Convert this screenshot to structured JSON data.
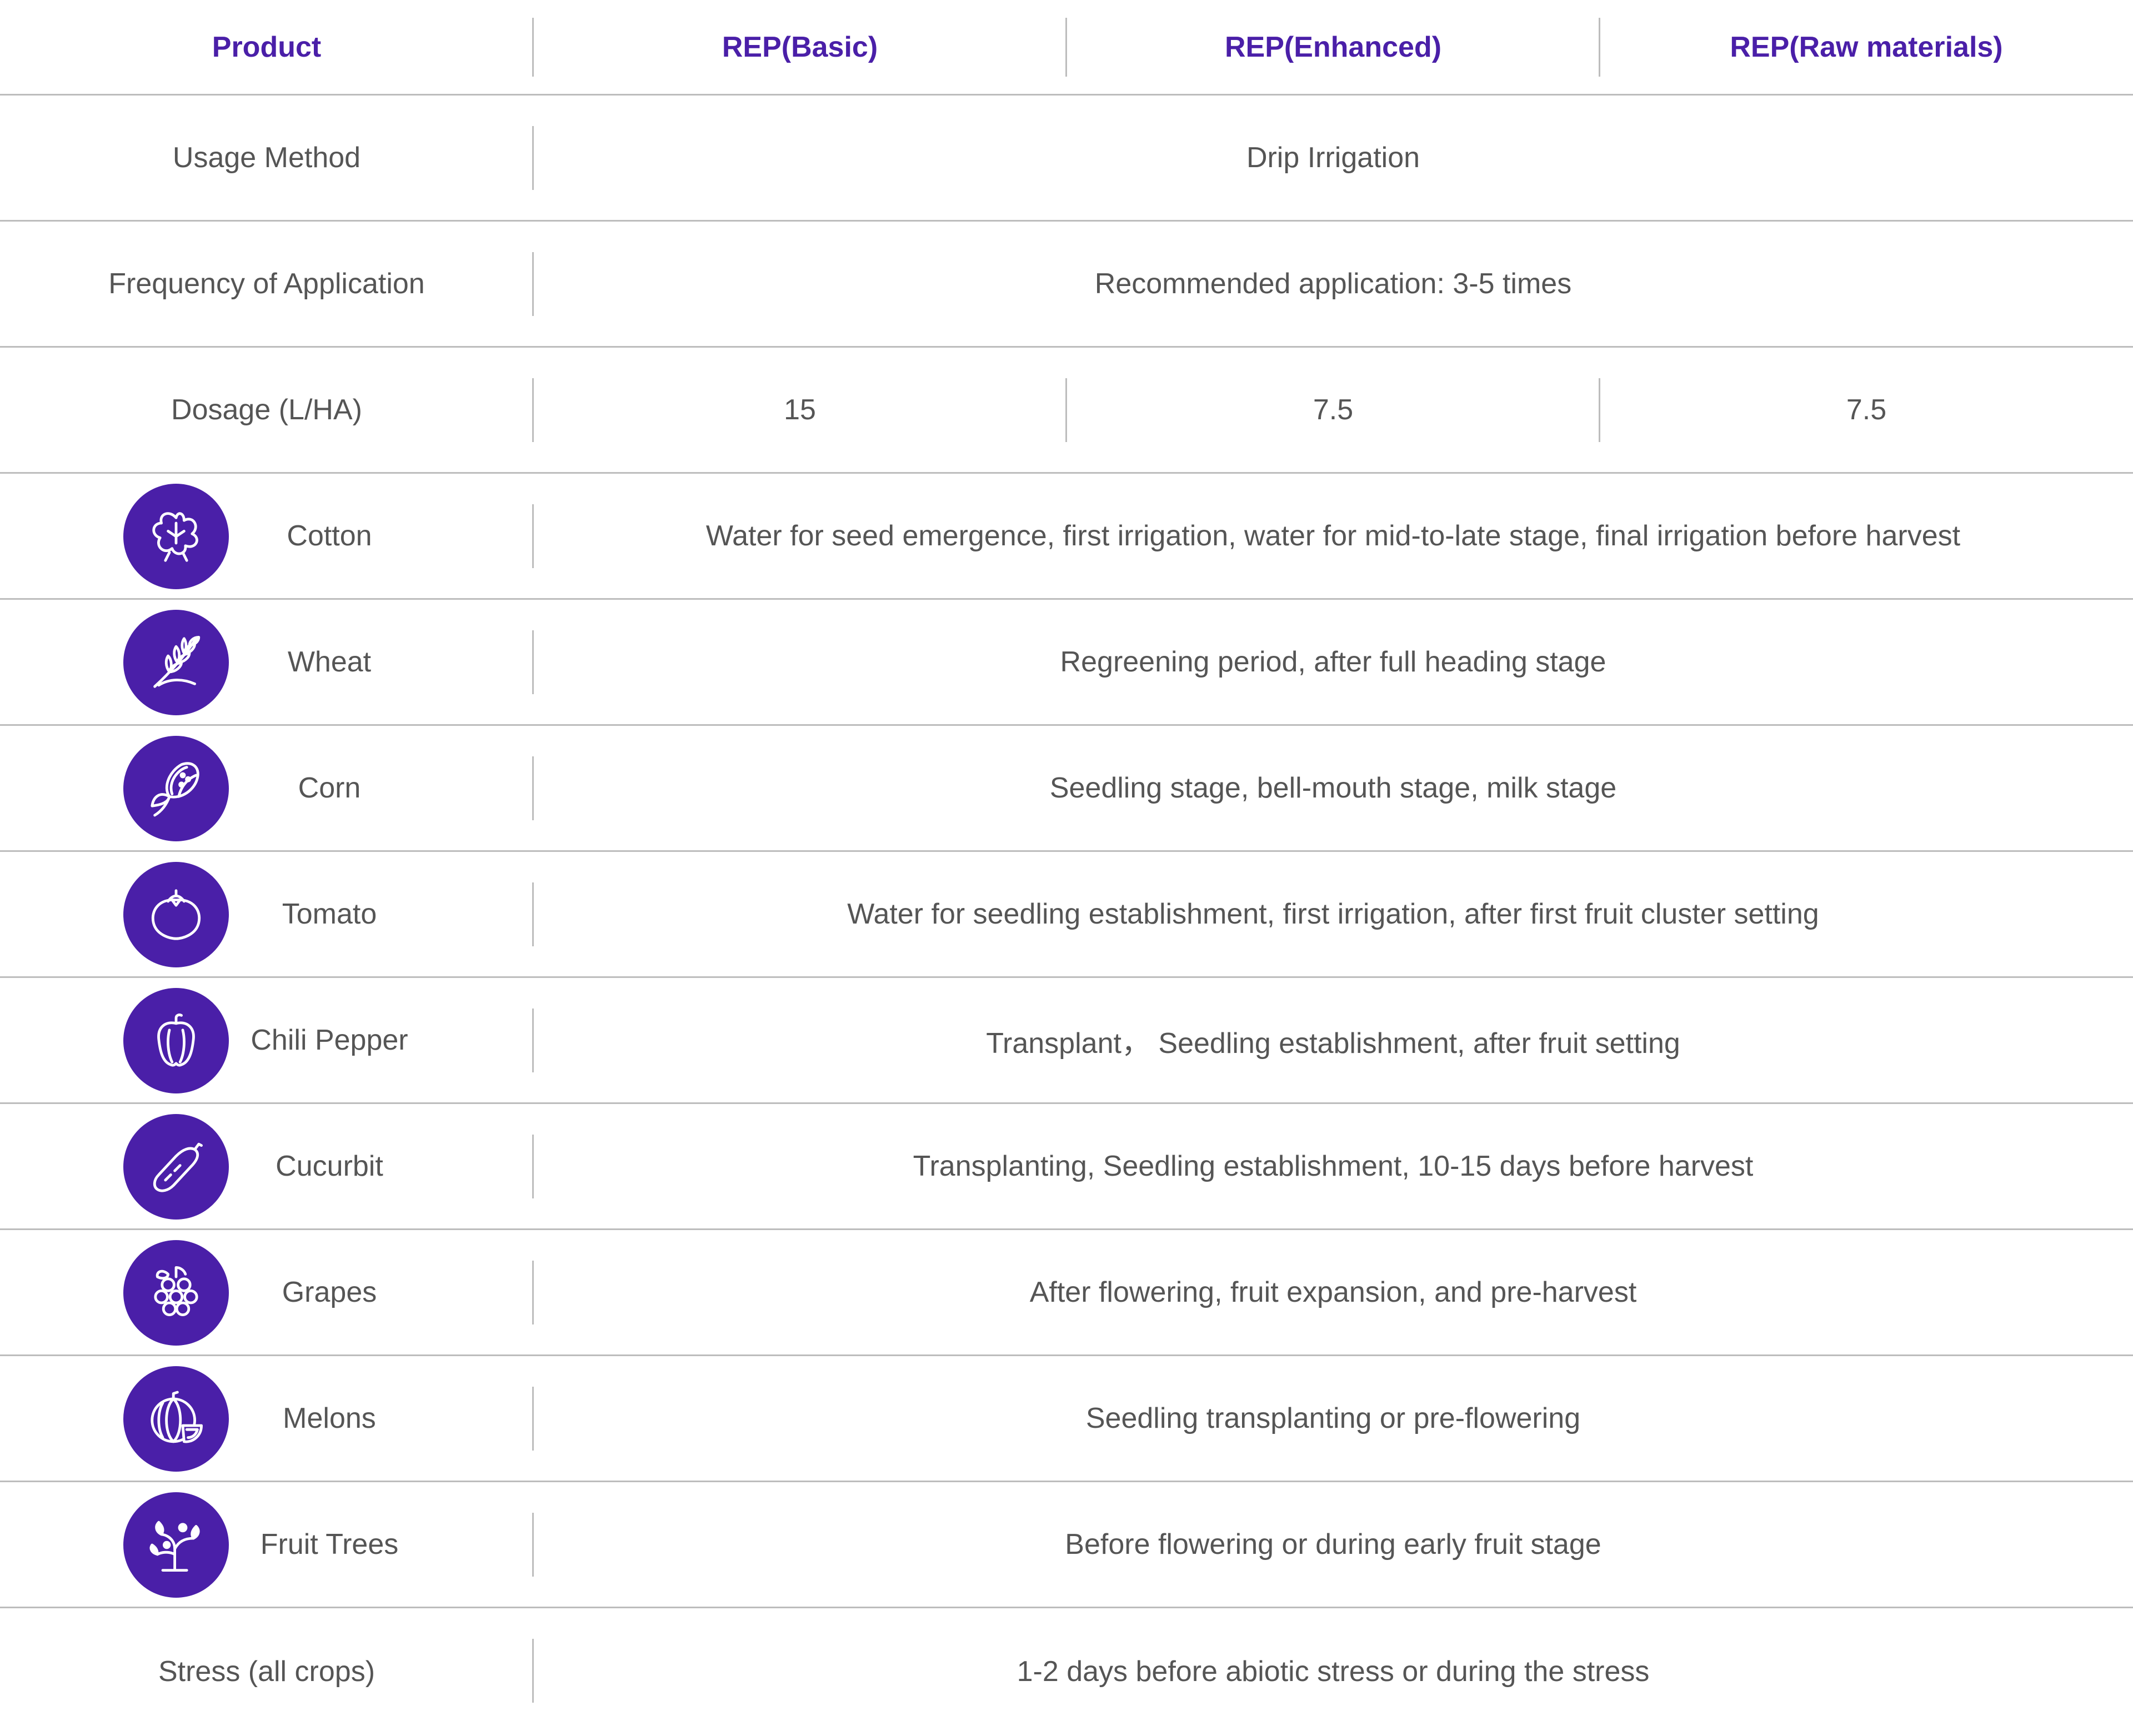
{
  "header": {
    "product": "Product",
    "basic": "REP(Basic)",
    "enhanced": "REP(Enhanced)",
    "raw": "REP(Raw materials)"
  },
  "rows": {
    "usage": {
      "label": "Usage Method",
      "value": "Drip Irrigation"
    },
    "frequency": {
      "label": "Frequency of Application",
      "value": "Recommended application: 3-5 times"
    },
    "dosage": {
      "label": "Dosage (L/HA)",
      "basic": "15",
      "enhanced": "7.5",
      "raw": "7.5"
    },
    "stress": {
      "label": "Stress (all crops)",
      "value": "1-2 days before abiotic stress or during the stress"
    }
  },
  "crops": [
    {
      "name": "Cotton",
      "icon": "cotton-icon",
      "timing": "Water for seed emergence, first irrigation, water for mid-to-late stage, final irrigation before harvest"
    },
    {
      "name": "Wheat",
      "icon": "wheat-icon",
      "timing": "Regreening period, after full heading stage"
    },
    {
      "name": "Corn",
      "icon": "corn-icon",
      "timing": "Seedling stage, bell-mouth stage, milk stage"
    },
    {
      "name": "Tomato",
      "icon": "tomato-icon",
      "timing": "Water for seedling establishment, first irrigation, after first fruit cluster setting"
    },
    {
      "name": "Chili Pepper",
      "icon": "pepper-icon",
      "timing": "Transplant， Seedling establishment, after fruit setting"
    },
    {
      "name": "Cucurbit",
      "icon": "cucumber-icon",
      "timing": "Transplanting, Seedling establishment, 10-15 days before harvest"
    },
    {
      "name": "Grapes",
      "icon": "grapes-icon",
      "timing": "After flowering, fruit expansion, and pre-harvest"
    },
    {
      "name": "Melons",
      "icon": "melon-icon",
      "timing": "Seedling transplanting or pre-flowering"
    },
    {
      "name": "Fruit Trees",
      "icon": "tree-icon",
      "timing": "Before flowering or during early fruit stage"
    }
  ],
  "colors": {
    "accent": "#4a1fa8",
    "text": "#555555",
    "divider": "#bdbdbd"
  }
}
